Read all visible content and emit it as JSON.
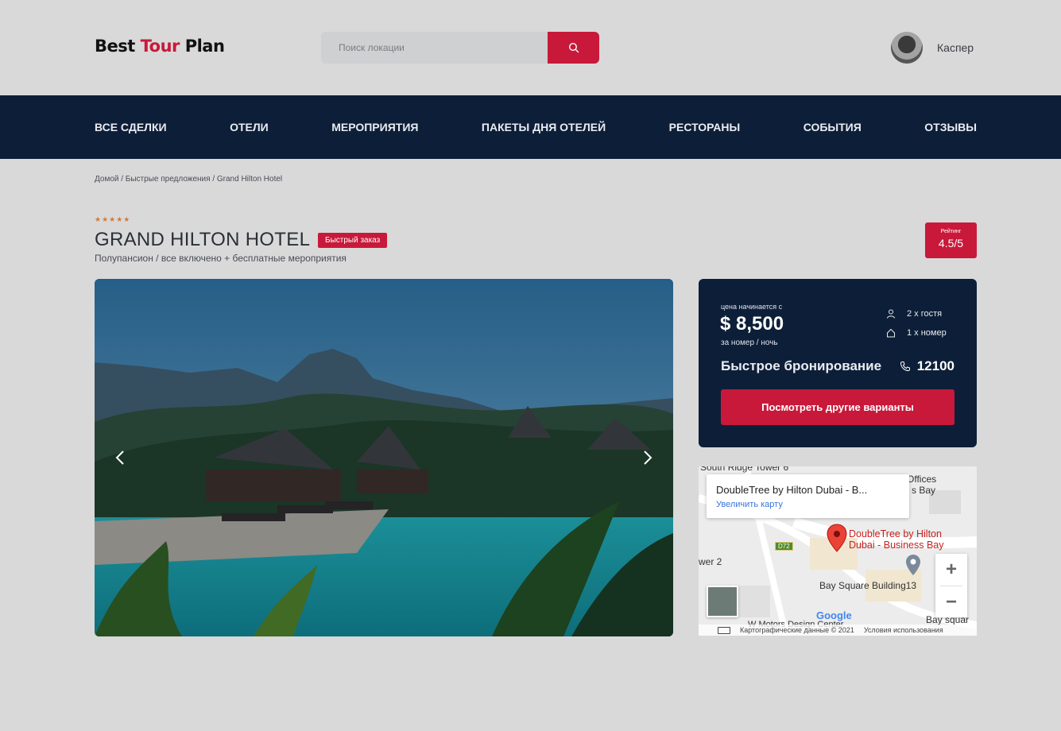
{
  "header": {
    "logo_part1": "Best ",
    "logo_part2": "Tour",
    "logo_part3": " Plan",
    "search_placeholder": "Поиск локации",
    "user_name": "Каспер"
  },
  "nav": {
    "items": [
      "Все сделки",
      "Отели",
      "Мероприятия",
      "Пакеты дня отелей",
      "Рестораны",
      "События",
      "Отзывы"
    ]
  },
  "breadcrumb": "Домой / Быстрые предложения / Grand Hilton Hotel",
  "hotel": {
    "stars": "★★★★★",
    "star_count": 5,
    "title": "GRAND HILTON HOTEL",
    "badge": "Быстрый заказ",
    "subtitle": "Полупансион / все включено + бесплатные мероприятия",
    "rating_label": "Рейтинг",
    "rating_value": "4.5/5"
  },
  "booking": {
    "price_label": "цена начинается с",
    "price": "$ 8,500",
    "price_unit": "за номер / ночь",
    "guests": "2 x гостя",
    "rooms": "1 x номер",
    "quick_label": "Быстрое бронирование",
    "phone": "12100",
    "cta": "Посмотреть другие варианты"
  },
  "map": {
    "card_title": "DoubleTree by Hilton Dubai - B...",
    "card_link": "Увеличить карту",
    "pin_label_1": "DoubleTree by Hilton",
    "pin_label_2": "Dubai - Business Bay",
    "labels": {
      "tower": "South Ridge Tower 6",
      "offices": "Offices",
      "bay": "s Bay",
      "tower2": "wer 2",
      "bay_square": "Bay Square Building13",
      "w_motors": "W Motors Design Center",
      "bay_squar": "Bay squar",
      "road": "D72"
    },
    "google": "Google",
    "footer_data": "Картографические данные © 2021",
    "footer_terms": "Условия использования",
    "zoom_in": "+",
    "zoom_out": "−"
  },
  "colors": {
    "accent": "#c8193a",
    "navy": "#0d1f38",
    "background": "#d9d9d9",
    "star": "#d27b3a"
  },
  "icons": [
    "search-icon",
    "user-icon",
    "home-icon",
    "phone-icon",
    "chevron-left-icon",
    "chevron-right-icon",
    "map-pin-icon",
    "keyboard-icon"
  ]
}
